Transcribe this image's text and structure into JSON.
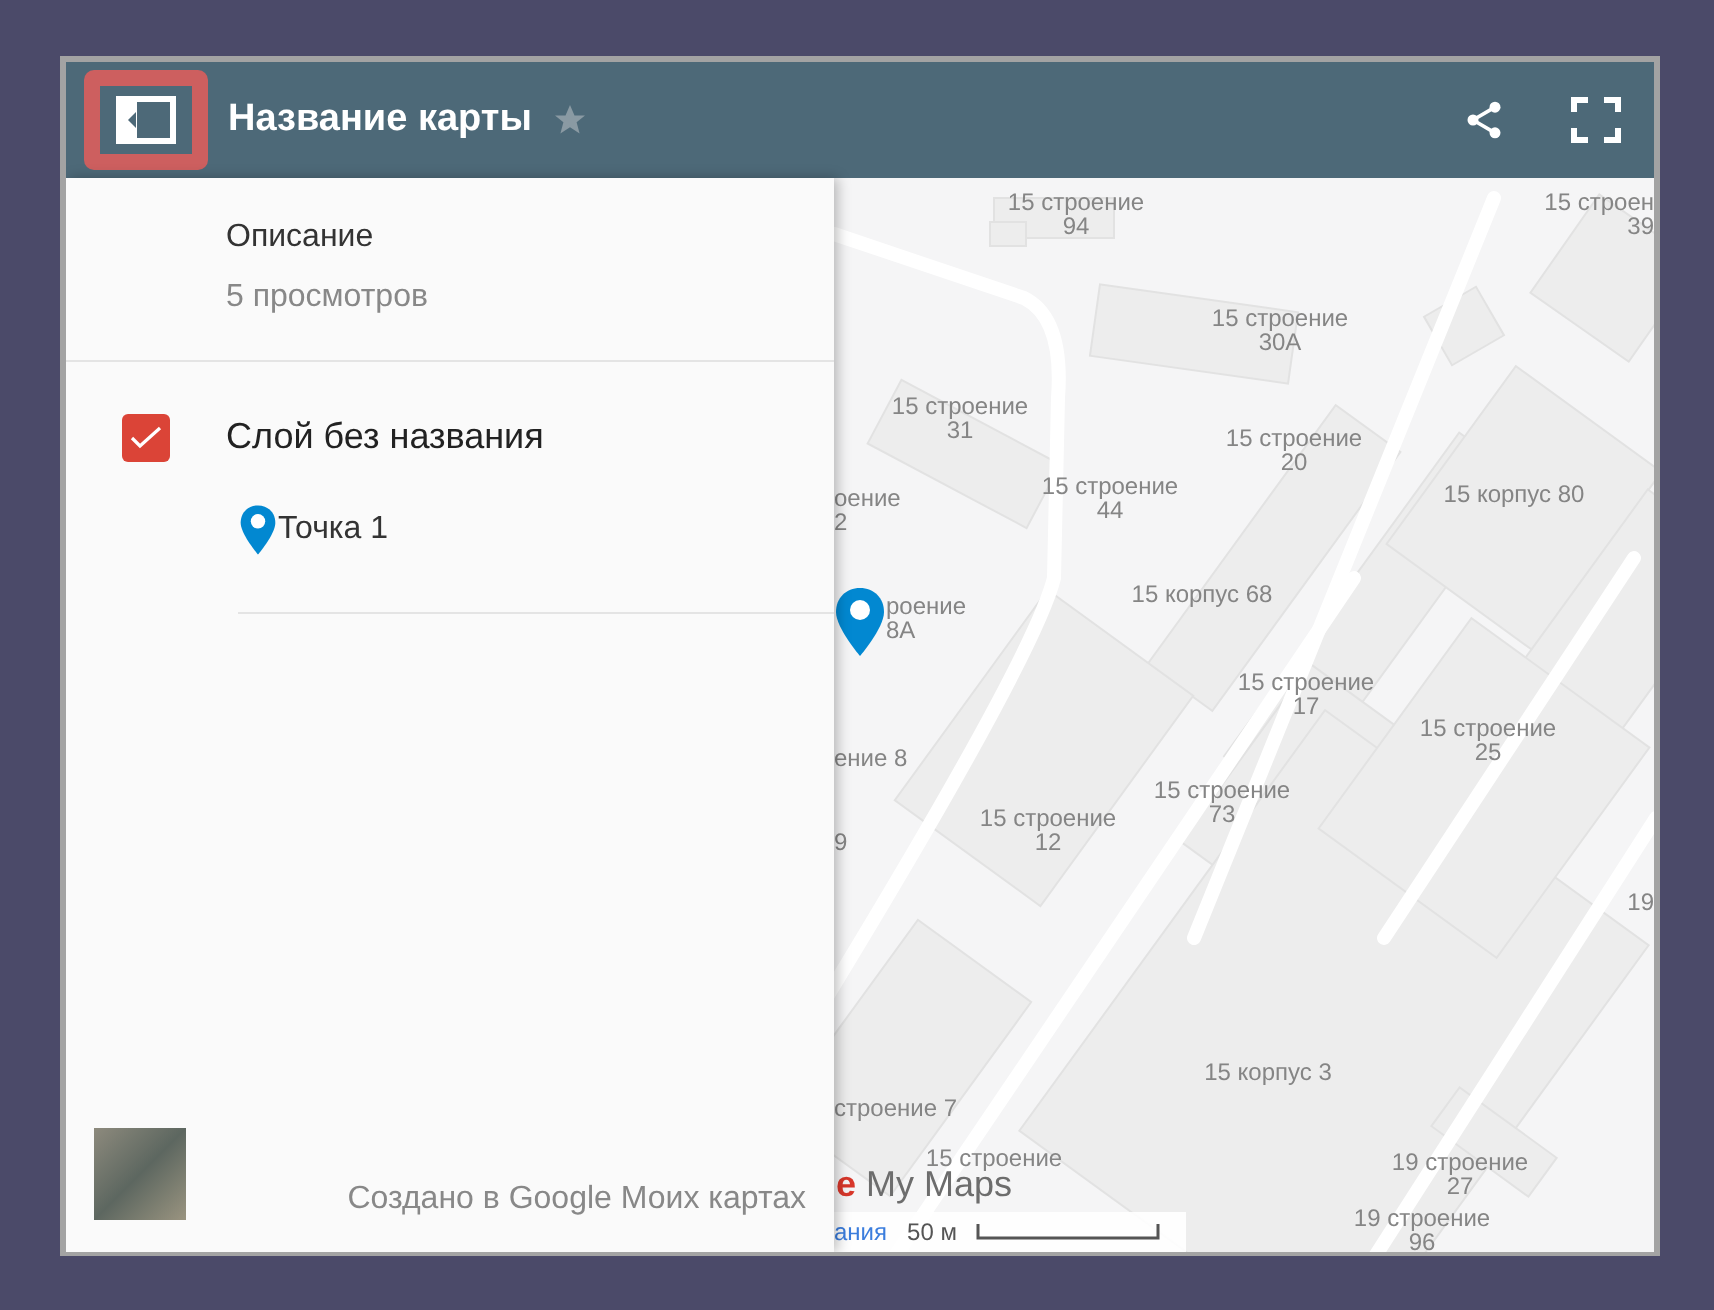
{
  "header": {
    "title": "Название карты",
    "starred": false
  },
  "sidebar": {
    "description": "Описание",
    "views": "5 просмотров",
    "layers": [
      {
        "name": "Слой без названия",
        "checked": true,
        "items": [
          {
            "name": "Точка 1"
          }
        ]
      }
    ],
    "footer": "Создано в Google Моих картах"
  },
  "map": {
    "labels": [
      {
        "lines": [
          "15 строение",
          "94"
        ]
      },
      {
        "lines": [
          "15 строен",
          "39"
        ]
      },
      {
        "lines": [
          "15 строение",
          "30А"
        ]
      },
      {
        "lines": [
          "15 строение",
          "31"
        ]
      },
      {
        "lines": [
          "15 строение",
          "20"
        ]
      },
      {
        "lines": [
          "15 строение",
          "44"
        ]
      },
      {
        "lines": [
          "оение",
          "2"
        ]
      },
      {
        "lines": [
          "15 корпус 80"
        ]
      },
      {
        "lines": [
          "15 корпус 68"
        ]
      },
      {
        "lines": [
          "роение",
          "8А"
        ]
      },
      {
        "lines": [
          "15 строение",
          "17"
        ]
      },
      {
        "lines": [
          "ение 8"
        ]
      },
      {
        "lines": [
          "15 строение",
          "25"
        ]
      },
      {
        "lines": [
          "15 строение",
          "12"
        ]
      },
      {
        "lines": [
          "15 строение",
          "73"
        ]
      },
      {
        "lines": [
          "9"
        ]
      },
      {
        "lines": [
          "19"
        ]
      },
      {
        "lines": [
          "15 корпус 3"
        ]
      },
      {
        "lines": [
          "строение 7"
        ]
      },
      {
        "lines": [
          "15 строение"
        ]
      },
      {
        "lines": [
          "19 строение",
          "27"
        ]
      },
      {
        "lines": [
          "19 строение",
          "96"
        ]
      }
    ],
    "logo": {
      "prefix": "e",
      "text": "My Maps"
    },
    "link": "ания",
    "scale": "50 м"
  }
}
